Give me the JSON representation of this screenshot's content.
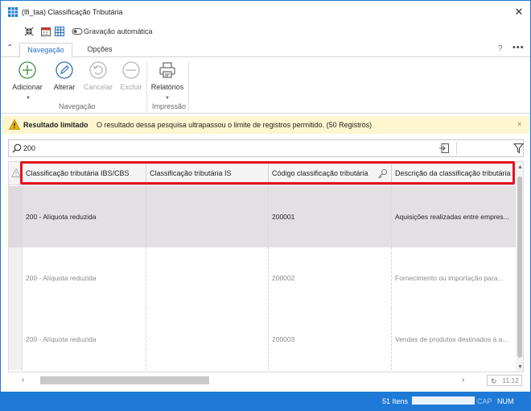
{
  "window": {
    "title": "(lfi_taa)  Classificação Tributária"
  },
  "quick_access": {
    "autosave_label": "Gravação automática"
  },
  "tabs": [
    {
      "label": "Navegação",
      "active": true
    },
    {
      "label": "Opções",
      "active": false
    }
  ],
  "title_controls": {
    "help": "?",
    "more": "•••",
    "close": "✕"
  },
  "ribbon": {
    "buttons": [
      {
        "label": "Adicionar",
        "icon": "plus-circle-icon",
        "enabled": true
      },
      {
        "label": "Alterar",
        "icon": "pencil-icon",
        "enabled": true
      },
      {
        "label": "Cancelar",
        "icon": "undo-icon",
        "enabled": false
      },
      {
        "label": "Excluir",
        "icon": "minus-circle-icon",
        "enabled": false
      },
      {
        "label": "Relatórios",
        "icon": "printer-icon",
        "enabled": true
      }
    ],
    "groups": [
      {
        "label": "Navegação"
      },
      {
        "label": "Impressão"
      }
    ]
  },
  "warning": {
    "title": "Resultado limitado",
    "message": "O resultado dessa pesquisa ultrapassou o limite de registros permitido. (50 Registros)",
    "close": "×"
  },
  "search": {
    "value": "200",
    "placeholder": ""
  },
  "grid": {
    "columns": [
      "Classificação tributária IBS/CBS",
      "Classificação tributária IS",
      "Código classificação tributária",
      "Descrição da classificação tributária"
    ],
    "rows": [
      {
        "ibs_cbs": "200 - Alíquota reduzida",
        "is": "",
        "codigo": "200001",
        "descricao": "Aquisições realizadas entre empres..."
      },
      {
        "ibs_cbs": "200 - Alíquota reduzida",
        "is": "",
        "codigo": "200002",
        "descricao": "Fornecimento ou importação para..."
      },
      {
        "ibs_cbs": "200 - Alíquota reduzida",
        "is": "",
        "codigo": "200003",
        "descricao": "Vendas de produtos destinados à a..."
      }
    ],
    "refresh_time": "11:12"
  },
  "status_bar": {
    "items": "51 Itens",
    "cap": "CAP",
    "num": "NUM"
  },
  "colors": {
    "accent": "#1e7ad6",
    "warning_bg": "#fdf6cf",
    "highlight": "#e3141e",
    "selected_row": "#e3e0e3"
  }
}
